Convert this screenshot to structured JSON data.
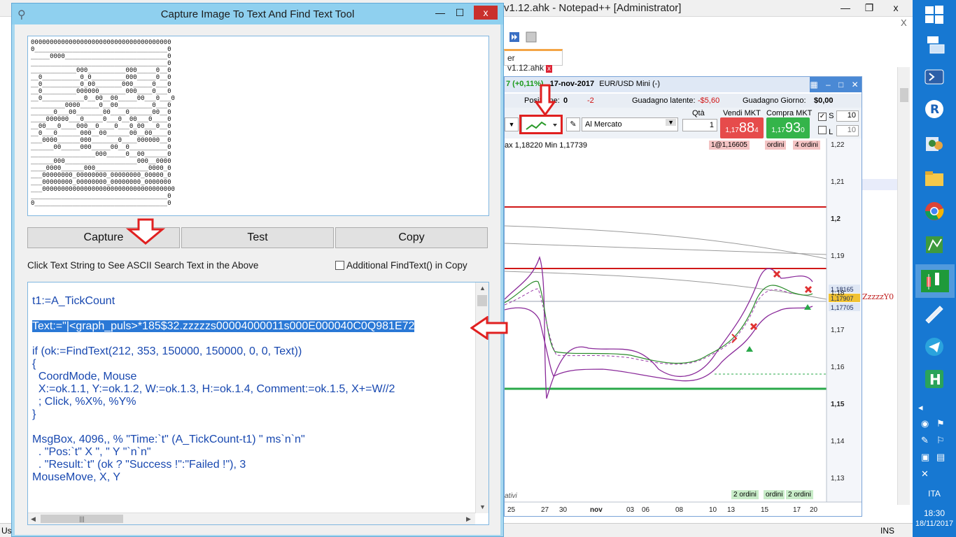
{
  "notepad": {
    "title": "v1.12.ahk - Notepad++ [Administrator]",
    "tab_label": "er v1.12.ahk",
    "close_glyph": "x",
    "minimize_glyph": "—",
    "maximize_glyph": "❐",
    "statusbar_left": "Us",
    "statusbar_ins": "INS"
  },
  "chart": {
    "change": "7 (+0,11%)",
    "date": "17-nov-2017",
    "pair": "EUR/USD Mini (-)",
    "position_label": "Posizione:",
    "position_value": "0",
    "position_value2": "-2",
    "latent_label": "Guadagno latente:",
    "latent_value": "-$5,60",
    "day_label": "Guadagno Giorno:",
    "day_value": "$0,00",
    "qty_label": "Qtà",
    "qty_value": "1",
    "sell_label": "Vendi MKT",
    "buy_label": "Compra MKT",
    "sell_price_prefix": "1,17",
    "sell_price_big": "88",
    "sell_price_sup": "4",
    "buy_price_prefix": "1,17",
    "buy_price_big": "93",
    "buy_price_sup": "0",
    "order_type": "Al Mercato",
    "s_label": "S",
    "s_value": "10",
    "l_label": "L",
    "l_value": "10",
    "range_text": "ax 1,18220 Min 1,17739",
    "order_badge_1": "1@1,16605",
    "order_badge_2": "ordini",
    "order_badge_3": "4 ordini",
    "bottom_badge_1": "2 ordini",
    "bottom_badge_2": "ordini",
    "bottom_badge_3": "2 ordini",
    "bottom_left_text": "ativi",
    "y_ticks": [
      "1,22",
      "1,21",
      "1,2",
      "1,19",
      "1,18",
      "1,17",
      "1,16",
      "1,15",
      "1,14",
      "1,13"
    ],
    "price_labels": [
      "1,18165",
      "1,17907",
      "1,17705"
    ],
    "x_ticks": [
      "25",
      "27",
      "30",
      "nov",
      "03",
      "06",
      "08",
      "10",
      "13",
      "15",
      "17",
      "20"
    ],
    "overlay_text": "ZzzzzY0",
    "accent_sell": "#e64b4b",
    "accent_buy": "#34b44a"
  },
  "tool": {
    "title": "Capture Image To Text And Find Text Tool",
    "ascii_lines": [
      "0000000000000000000000000000000000000",
      "0___________________________________0",
      "_____0000___________________________0",
      "____________________________________0",
      "____________000__________000_____0__0",
      "__0__________0_0_________000_____0__0",
      "__0__________0_00_______000_____0___0",
      "__0_________000000_______000____0___0",
      "__0___________0__00__00_____00___0___0",
      "_________0000_____0__00_________0___0",
      "______0___00_______00____0______00__0",
      "____000000___0_____0___0__00___0____0",
      "__00___0____000__0____0___0_00___0__0",
      "__0___0______000__00______00__00____0",
      "___0000______000_______0____000000__0",
      "______00_____000_____00__0__________0",
      "_________________000_____0__00______0",
      "______000___________________000__0000",
      "____0000______000______________0000_0",
      "___00000000_00000000_00000000_00000_0",
      "___00000000_00000000_00000000_0000000",
      "___00000000000000000000000000000000000",
      "____________________________________0",
      "0___________________________________0"
    ],
    "capture_label": "Capture",
    "test_label": "Test",
    "copy_label": "Copy",
    "hint": "Click Text String to See ASCII Search Text in the Above",
    "extra_label": "Additional FindText() in Copy",
    "code_lines": [
      "t1:=A_TickCount",
      "",
      "Text:=\"|<graph_puls>*185$32.zzzzzs00004000011s000E000040C0Q981E72",
      "",
      "if (ok:=FindText(212, 353, 150000, 150000, 0, 0, Text))",
      "{",
      "  CoordMode, Mouse",
      "  X:=ok.1.1, Y:=ok.1.2, W:=ok.1.3, H:=ok.1.4, Comment:=ok.1.5, X+=W//2",
      "  ; Click, %X%, %Y%",
      "}",
      "",
      "MsgBox, 4096,, % \"Time:`t\" (A_TickCount-t1) \" ms`n`n\"",
      "  . \"Pos:`t\" X \", \" Y \"`n`n\"",
      "  . \"Result:`t\" (ok ? \"Success !\":\"Failed !\"), 3",
      "MouseMove, X, Y"
    ],
    "hscroll_thumb": "|||",
    "close_glyph": "x",
    "minimize_glyph": "—",
    "maximize_glyph": "☐"
  },
  "taskbar": {
    "lang": "ITA",
    "time": "18:30",
    "date": "18/11/2017"
  }
}
